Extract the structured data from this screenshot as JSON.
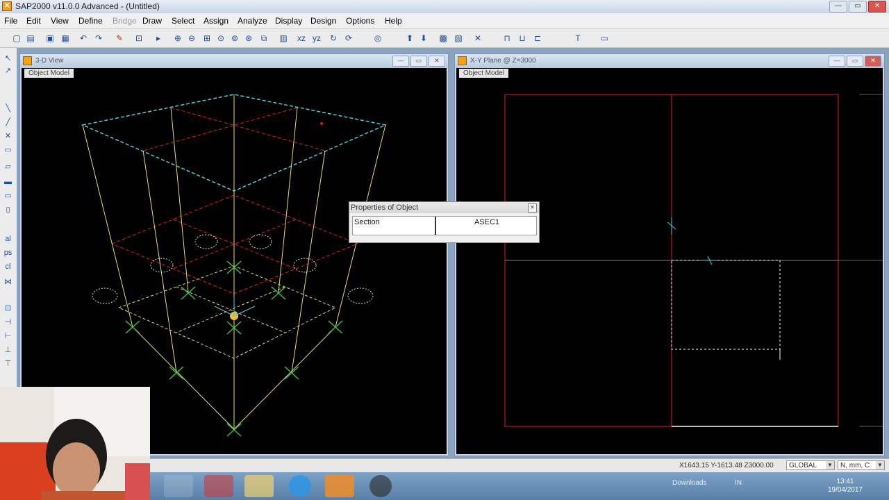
{
  "app": {
    "title": "SAP2000 v11.0.0 Advanced - (Untitled)",
    "icon": "sap2000-logo-icon",
    "window_buttons": [
      "minimize",
      "maximize",
      "close"
    ]
  },
  "menu": {
    "items": [
      {
        "label": "File",
        "enabled": true
      },
      {
        "label": "Edit",
        "enabled": true
      },
      {
        "label": "View",
        "enabled": true
      },
      {
        "label": "Define",
        "enabled": true
      },
      {
        "label": "Bridge",
        "enabled": false
      },
      {
        "label": "Draw",
        "enabled": true
      },
      {
        "label": "Select",
        "enabled": true
      },
      {
        "label": "Assign",
        "enabled": true
      },
      {
        "label": "Analyze",
        "enabled": true
      },
      {
        "label": "Display",
        "enabled": true
      },
      {
        "label": "Design",
        "enabled": true
      },
      {
        "label": "Options",
        "enabled": true
      },
      {
        "label": "Help",
        "enabled": true
      }
    ]
  },
  "toolbar": {
    "icons": [
      "new-icon",
      "open-icon",
      "save-icon",
      "save-as-icon",
      "undo-icon",
      "redo-icon",
      "pencil-icon",
      "lock-icon",
      "run-icon",
      "zoom-in-icon",
      "zoom-out-icon",
      "zoom-window-icon",
      "zoom-prev-icon",
      "zoom-all-icon",
      "zoom-step-icon",
      "view-3d-icon",
      "view-xy-icon",
      "view-xz-icon",
      "view-yz-icon",
      "rotate-icon",
      "refresh-icon",
      "up-arrow-icon",
      "down-arrow-icon",
      "show-icon",
      "text-icon",
      "display-icon"
    ]
  },
  "views": {
    "left": {
      "title": "3-D View",
      "tag": "Object Model"
    },
    "right": {
      "title": "X-Y Plane @ Z=3000",
      "tag": "Object Model"
    }
  },
  "properties_dialog": {
    "title": "Properties of Object",
    "field_label": "Section",
    "field_value": "ASEC1"
  },
  "status": {
    "coords": "X1643.15  Y-1613.48  Z3000.00",
    "coordinate_system": "GLOBAL",
    "units": "N, mm, C"
  },
  "taskbar": {
    "apps": [
      "app-swirl-icon",
      "app-cube-icon",
      "folder-icon",
      "skype-icon",
      "sap2000-icon",
      "media-icon"
    ],
    "tray_label": "Downloads",
    "language": "IN",
    "time": "13:41",
    "date": "19/04/2017"
  },
  "colors": {
    "grid_red": "#e02020",
    "frame_yellow": "#e8e070",
    "beam_cyan": "#50d0e0",
    "support_green": "#40c040"
  }
}
